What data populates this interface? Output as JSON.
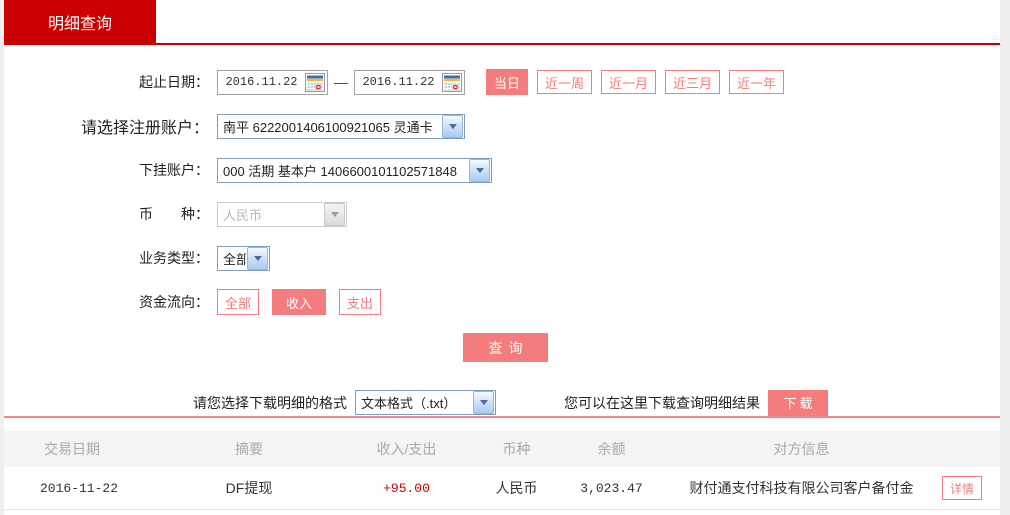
{
  "tab": {
    "label": "明细查询"
  },
  "form": {
    "date_range": {
      "label": "起止日期：",
      "from": "2016.11.22",
      "separator": "—",
      "to": "2016.11.22"
    },
    "quick_ranges": [
      {
        "label": "当日",
        "active": true
      },
      {
        "label": "近一周",
        "active": false
      },
      {
        "label": "近一月",
        "active": false
      },
      {
        "label": "近三月",
        "active": false
      },
      {
        "label": "近一年",
        "active": false
      }
    ],
    "register_account": {
      "label": "请选择注册账户：",
      "value": "南平 6222001406100921065 灵通卡"
    },
    "sub_account": {
      "label": "下挂账户：",
      "value": "000 活期 基本户 1406600101102571848"
    },
    "currency": {
      "label": "币　　种：",
      "value": "人民币",
      "disabled": true
    },
    "business_type": {
      "label": "业务类型：",
      "value": "全部"
    },
    "fund_flow": {
      "label": "资金流向：",
      "options": [
        {
          "label": "全部",
          "active": false
        },
        {
          "label": "收入",
          "active": true
        },
        {
          "label": "支出",
          "active": false
        }
      ]
    },
    "query_button": "查询"
  },
  "download": {
    "format_label": "请您选择下载明细的格式",
    "format_value": "文本格式（.txt）",
    "hint": "您可以在这里下载查询明细结果",
    "button_label": "下载"
  },
  "table": {
    "headers": [
      "交易日期",
      "摘要",
      "收入/支出",
      "币种",
      "余额",
      "对方信息"
    ],
    "rows": [
      {
        "date": "2016-11-22",
        "summary": "DF提现",
        "amount": "+95.00",
        "currency": "人民币",
        "balance": "3,023.47",
        "counterparty": "财付通支付科技有限公司客户备付金",
        "action": "详情"
      }
    ]
  },
  "colors": {
    "accent_red": "#cc0000",
    "salmon": "#f47c7c",
    "amount_positive": "#cc0000",
    "header_text": "#a9a9a9"
  }
}
